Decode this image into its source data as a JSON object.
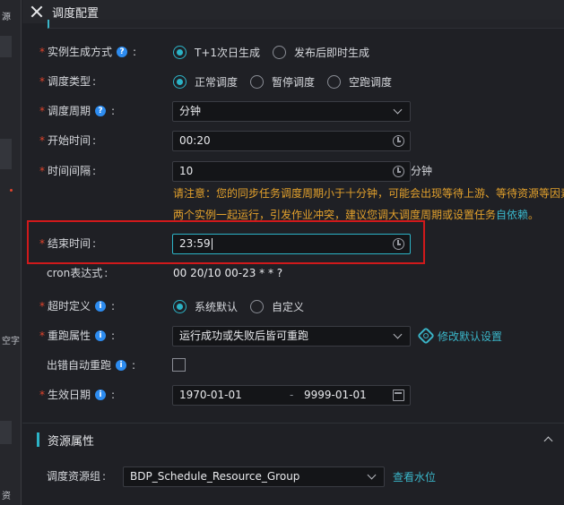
{
  "window": {
    "title": "调度配置"
  },
  "left_fragments": [
    "源",
    "空字",
    "资"
  ],
  "form": {
    "instance_mode": {
      "label": "实例生成方式",
      "options": [
        "T+1次日生成",
        "发布后即时生成"
      ],
      "selected": "T+1次日生成"
    },
    "schedule_type": {
      "label": "调度类型",
      "options": [
        "正常调度",
        "暂停调度",
        "空跑调度"
      ],
      "selected": "正常调度"
    },
    "schedule_period": {
      "label": "调度周期",
      "value": "分钟"
    },
    "start_time": {
      "label": "开始时间",
      "value": "00:20"
    },
    "interval": {
      "label": "时间间隔",
      "value": "10",
      "unit": "分钟",
      "warning_line1": "请注意：您的同步任务调度周期小于十分钟，可能会出现等待上游、等待资源等因素",
      "warning_line2_prefix": "两个实例一起运行，引发作业冲突，建议您调大调度周期或设置任务",
      "warning_link": "自依赖",
      "warning_suffix": "。"
    },
    "end_time": {
      "label": "结束时间",
      "value": "23:59"
    },
    "cron": {
      "label": "cron表达式",
      "value": "00 20/10 00-23 * * ?"
    },
    "timeout": {
      "label": "超时定义",
      "options": [
        "系统默认",
        "自定义"
      ],
      "selected": "系统默认"
    },
    "rerun": {
      "label": "重跑属性",
      "value": "运行成功或失败后皆可重跑",
      "link": "修改默认设置"
    },
    "auto_rerun": {
      "label": "出错自动重跑",
      "checked": false
    },
    "effective_date": {
      "label": "生效日期",
      "start": "1970-01-01",
      "separator": "-",
      "end": "9999-01-01"
    }
  },
  "resource_section": {
    "title": "资源属性",
    "group_label": "调度资源组",
    "group_value": "BDP_Schedule_Resource_Group",
    "link": "查看水位"
  },
  "colors": {
    "accent": "#2cb3c6",
    "required": "#e0442c",
    "warning": "#e3a12c",
    "highlight_box": "#d0191b"
  }
}
